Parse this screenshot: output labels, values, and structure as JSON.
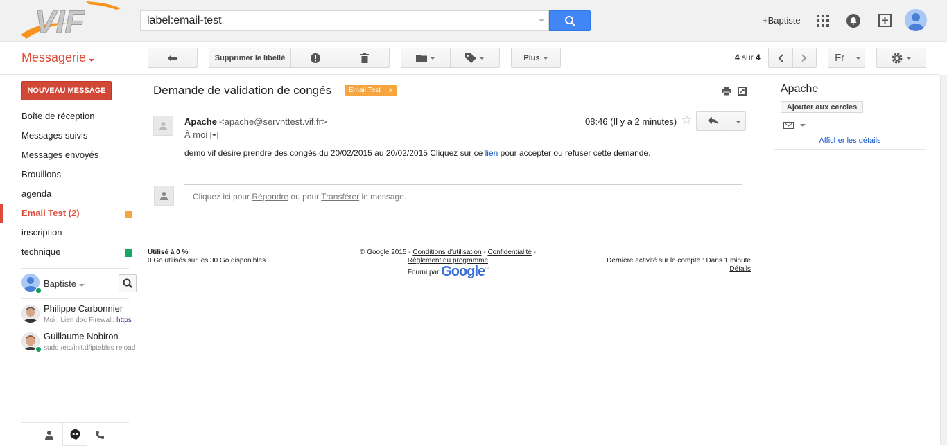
{
  "colors": {
    "accent": "#dd4b39",
    "compose": "#d14836",
    "search_button": "#4285f4",
    "label_email_test": "#f7a63f",
    "label_technique": "#16a765"
  },
  "header": {
    "logo_text": "VIF",
    "search_value": "label:email-test",
    "account_link": "+Baptiste",
    "icons": [
      "search-icon",
      "apps-grid-icon",
      "notifications-icon",
      "share-plus-icon",
      "account-avatar"
    ]
  },
  "toolbar": {
    "brand": "Messagerie",
    "back_icon": "back-arrow-icon",
    "remove_label": "Supprimer le libellé",
    "spam_icon": "report-spam-icon",
    "delete_icon": "trash-icon",
    "move_icon": "folder-icon",
    "labels_icon": "label-tag-icon",
    "more": "Plus",
    "pager_current": "4",
    "pager_sep": "sur",
    "pager_total": "4",
    "lang": "Fr",
    "settings_icon": "gear-icon"
  },
  "sidebar": {
    "compose": "NOUVEAU MESSAGE",
    "items": [
      {
        "label": "Boîte de réception"
      },
      {
        "label": "Messages suivis"
      },
      {
        "label": "Messages envoyés"
      },
      {
        "label": "Brouillons"
      },
      {
        "label": "agenda"
      },
      {
        "label": "Email Test (2)",
        "active": true
      },
      {
        "label": "inscription"
      },
      {
        "label": "technique"
      }
    ]
  },
  "chat": {
    "self_name": "Baptiste",
    "contacts": [
      {
        "name": "Philippe Carbonnier",
        "sub": "Moi : Lien doc Firewall: ",
        "link": "https"
      },
      {
        "name": "Guillaume Nobiron",
        "sub": "sudo /etc/init.d/iptables reload"
      }
    ]
  },
  "message": {
    "subject": "Demande de validation de congés",
    "label_chip": "Email Test",
    "label_close": "x",
    "sender_name": "Apache",
    "sender_email": "<apache@servnttest.vif.fr>",
    "to": "À moi",
    "time": "08:46 (Il y a 2 minutes)",
    "body_before": "demo vif désire prendre des congés du 20/02/2015 au 20/02/2015 Cliquez sur ce ",
    "body_link": "lien",
    "body_after": " pour accepter ou refuser cette demande.",
    "reply_prefix": "Cliquez ici pour ",
    "reply_link": "Répondre",
    "reply_mid": " ou pour ",
    "forward_link": "Transférer",
    "reply_suffix": " le message."
  },
  "footer": {
    "usage_title": "Utilisé à 0 %",
    "usage_detail": "0 Go utilisés sur les 30 Go disponibles",
    "copyright": "© Google 2015 - ",
    "terms": "Conditions d'utilisation",
    "dash1": " - ",
    "privacy": "Confidentialité",
    "dash2": " -",
    "program": "Règlement du programme",
    "powered_by": "Fourni par",
    "google": "Google",
    "tm": "™",
    "last_activity": "Dernière activité sur le compte : Dans 1 minute",
    "details": "Détails"
  },
  "right_pane": {
    "name": "Apache",
    "add_circles": "Ajouter aux cercles",
    "show_details": "Afficher les détails"
  }
}
